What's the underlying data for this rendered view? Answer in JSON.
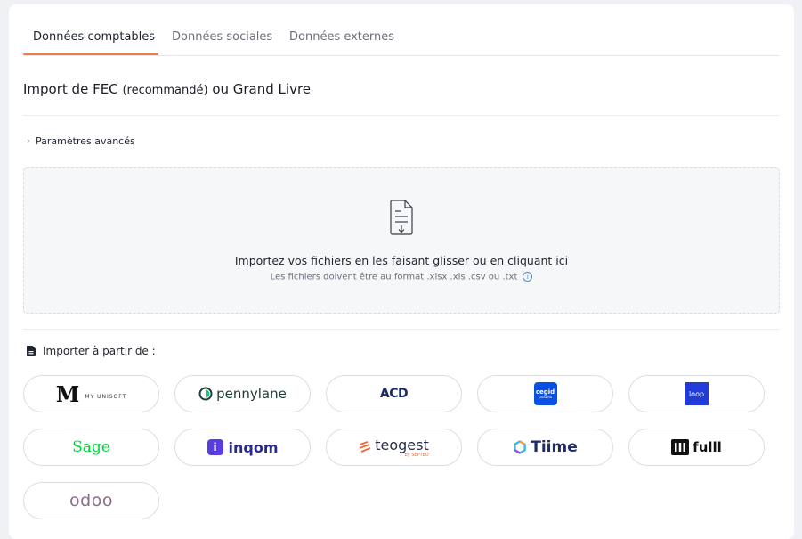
{
  "tabs": [
    {
      "label": "Données comptables",
      "active": true
    },
    {
      "label": "Données sociales",
      "active": false
    },
    {
      "label": "Données externes",
      "active": false
    }
  ],
  "section": {
    "title_main": "Import de FEC",
    "title_small": "(recommandé)",
    "title_tail": "ou Grand Livre"
  },
  "advanced": {
    "label": "Paramètres avancés",
    "icon": "chevron-right-icon"
  },
  "dropzone": {
    "icon": "file-download-icon",
    "main": "Importez vos fichiers en les faisant glisser ou en cliquant ici",
    "formats": "Les fichiers doivent être au format .xlsx .xls .csv ou .txt",
    "info_icon": "info-icon",
    "info_glyph": "i"
  },
  "import_from": {
    "label": "Importer à partir de :",
    "icon": "document-icon"
  },
  "providers": [
    {
      "name": "myunisoft",
      "mark": "M",
      "text": "MY UNISOFT",
      "color": "#111111"
    },
    {
      "name": "pennylane",
      "text": "pennylane",
      "color": "#1d3b36",
      "accent": "#1fc07a"
    },
    {
      "name": "acd",
      "text": "ACD",
      "color": "#1a2a6c"
    },
    {
      "name": "cegid",
      "text": "cegid",
      "subtext": "QUADRA",
      "color": "#0b50e6"
    },
    {
      "name": "loop",
      "text": "loop",
      "color": "#1f3bd9"
    },
    {
      "name": "sage",
      "text": "Sage",
      "color": "#00d639"
    },
    {
      "name": "inqom",
      "text": "inqom",
      "mark": "i",
      "color": "#2a2a8c",
      "accent": "#5a3de0"
    },
    {
      "name": "teogest",
      "text": "teogest",
      "subtext": "by SEPTEO",
      "color": "#2a2d4a",
      "accent": "#f06a3c"
    },
    {
      "name": "tiime",
      "text": "Tiime",
      "color": "#1f2a6b"
    },
    {
      "name": "fulll",
      "text": "fulll",
      "color": "#111111"
    },
    {
      "name": "odoo",
      "text": "odoo",
      "color": "#8f6b8b"
    }
  ]
}
